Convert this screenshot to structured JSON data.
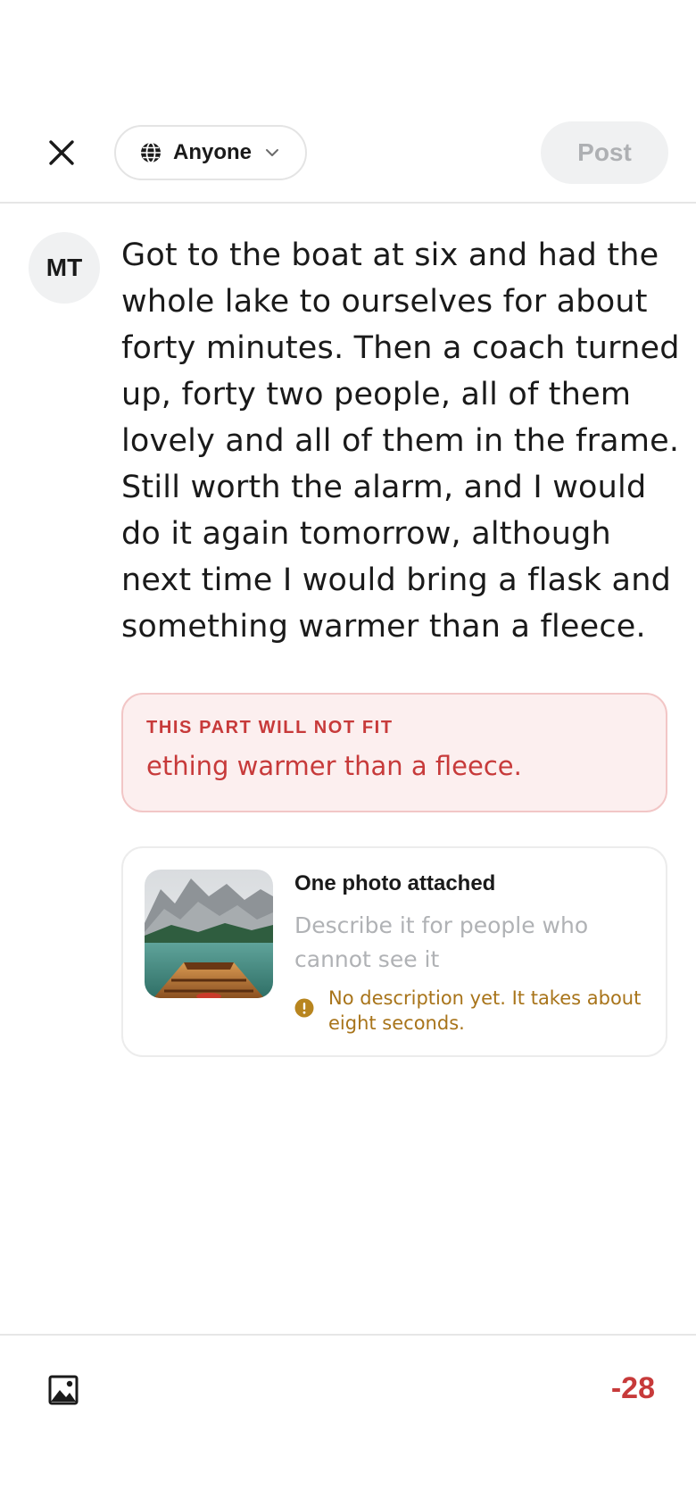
{
  "header": {
    "audience_label": "Anyone",
    "post_label": "Post"
  },
  "user": {
    "initials": "MT"
  },
  "composer": {
    "text": "Got to the boat at six and had the whole lake to ourselves for about forty minutes. Then a coach turned up, forty two people, all of them lovely and all of them in the frame. Still worth the alarm, and I would do it again tomorrow, although next time I would bring a flask and something warmer than a fleece."
  },
  "overflow": {
    "title": "THIS PART WILL NOT FIT",
    "text": "ething warmer than a fleece."
  },
  "attachment": {
    "title": "One photo attached",
    "alt_placeholder": "Describe it for people who cannot see it",
    "warning": "No description yet. It takes about eight seconds."
  },
  "footer": {
    "counter": "-28"
  },
  "colors": {
    "error": "#c73a3a",
    "error_bg": "#fcefef",
    "warning": "#a8741a",
    "post_disabled_bg": "#f0f1f2"
  },
  "icons": {
    "close": "close-icon",
    "audience": "globe-icon",
    "dropdown": "chevron-down-icon",
    "warning": "alert-circle-icon",
    "add_image": "image-icon"
  }
}
